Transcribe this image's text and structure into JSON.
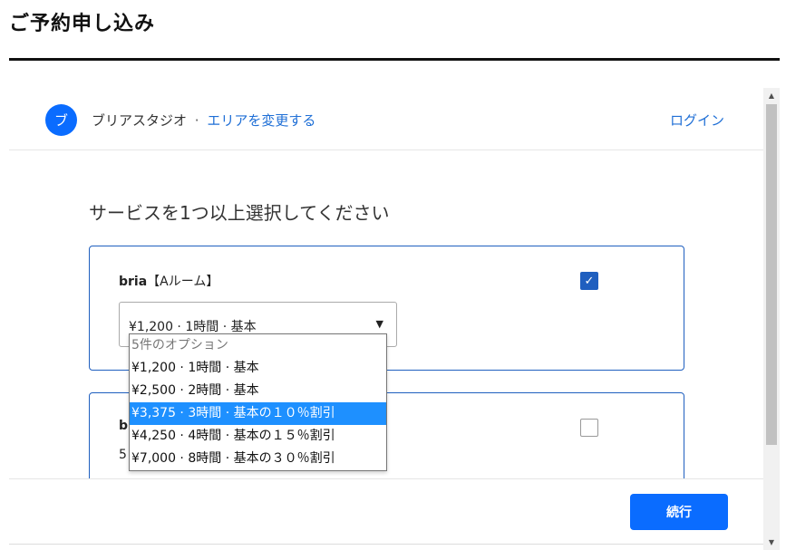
{
  "page": {
    "title": "ご予約申し込み"
  },
  "header": {
    "avatar_letter": "ブ",
    "studio_name": "ブリアスタジオ",
    "separator": "·",
    "change_area_link": "エリアを変更する",
    "login_link": "ログイン"
  },
  "main": {
    "heading": "サービスを1つ以上選択してください",
    "services": [
      {
        "brand": "bria",
        "room": "【Aルーム】",
        "checked": true,
        "check_glyph": "✓",
        "select": {
          "value": "¥1,200 · 1時間 · 基本",
          "arrow": "▼",
          "options": [
            "5件のオプション",
            "¥1,200 · 1時間 · 基本",
            "¥2,500 · 2時間 · 基本",
            "¥3,375 · 3時間 · 基本の１０％割引",
            "¥4,250 · 4時間 · 基本の１５％割引",
            "¥7,000 · 8時間 · 基本の３０％割引"
          ],
          "highlighted_index": 3
        }
      },
      {
        "brand": "b",
        "sub": "5",
        "checked": false
      }
    ]
  },
  "footer": {
    "continue_button": "続行"
  },
  "scrollbar": {
    "up_arrow": "▲",
    "down_arrow": "▼"
  },
  "colors": {
    "accent": "#0a6cff",
    "link": "#1f6fd6",
    "card_border": "#1f5fbf",
    "highlight": "#1e90ff"
  }
}
